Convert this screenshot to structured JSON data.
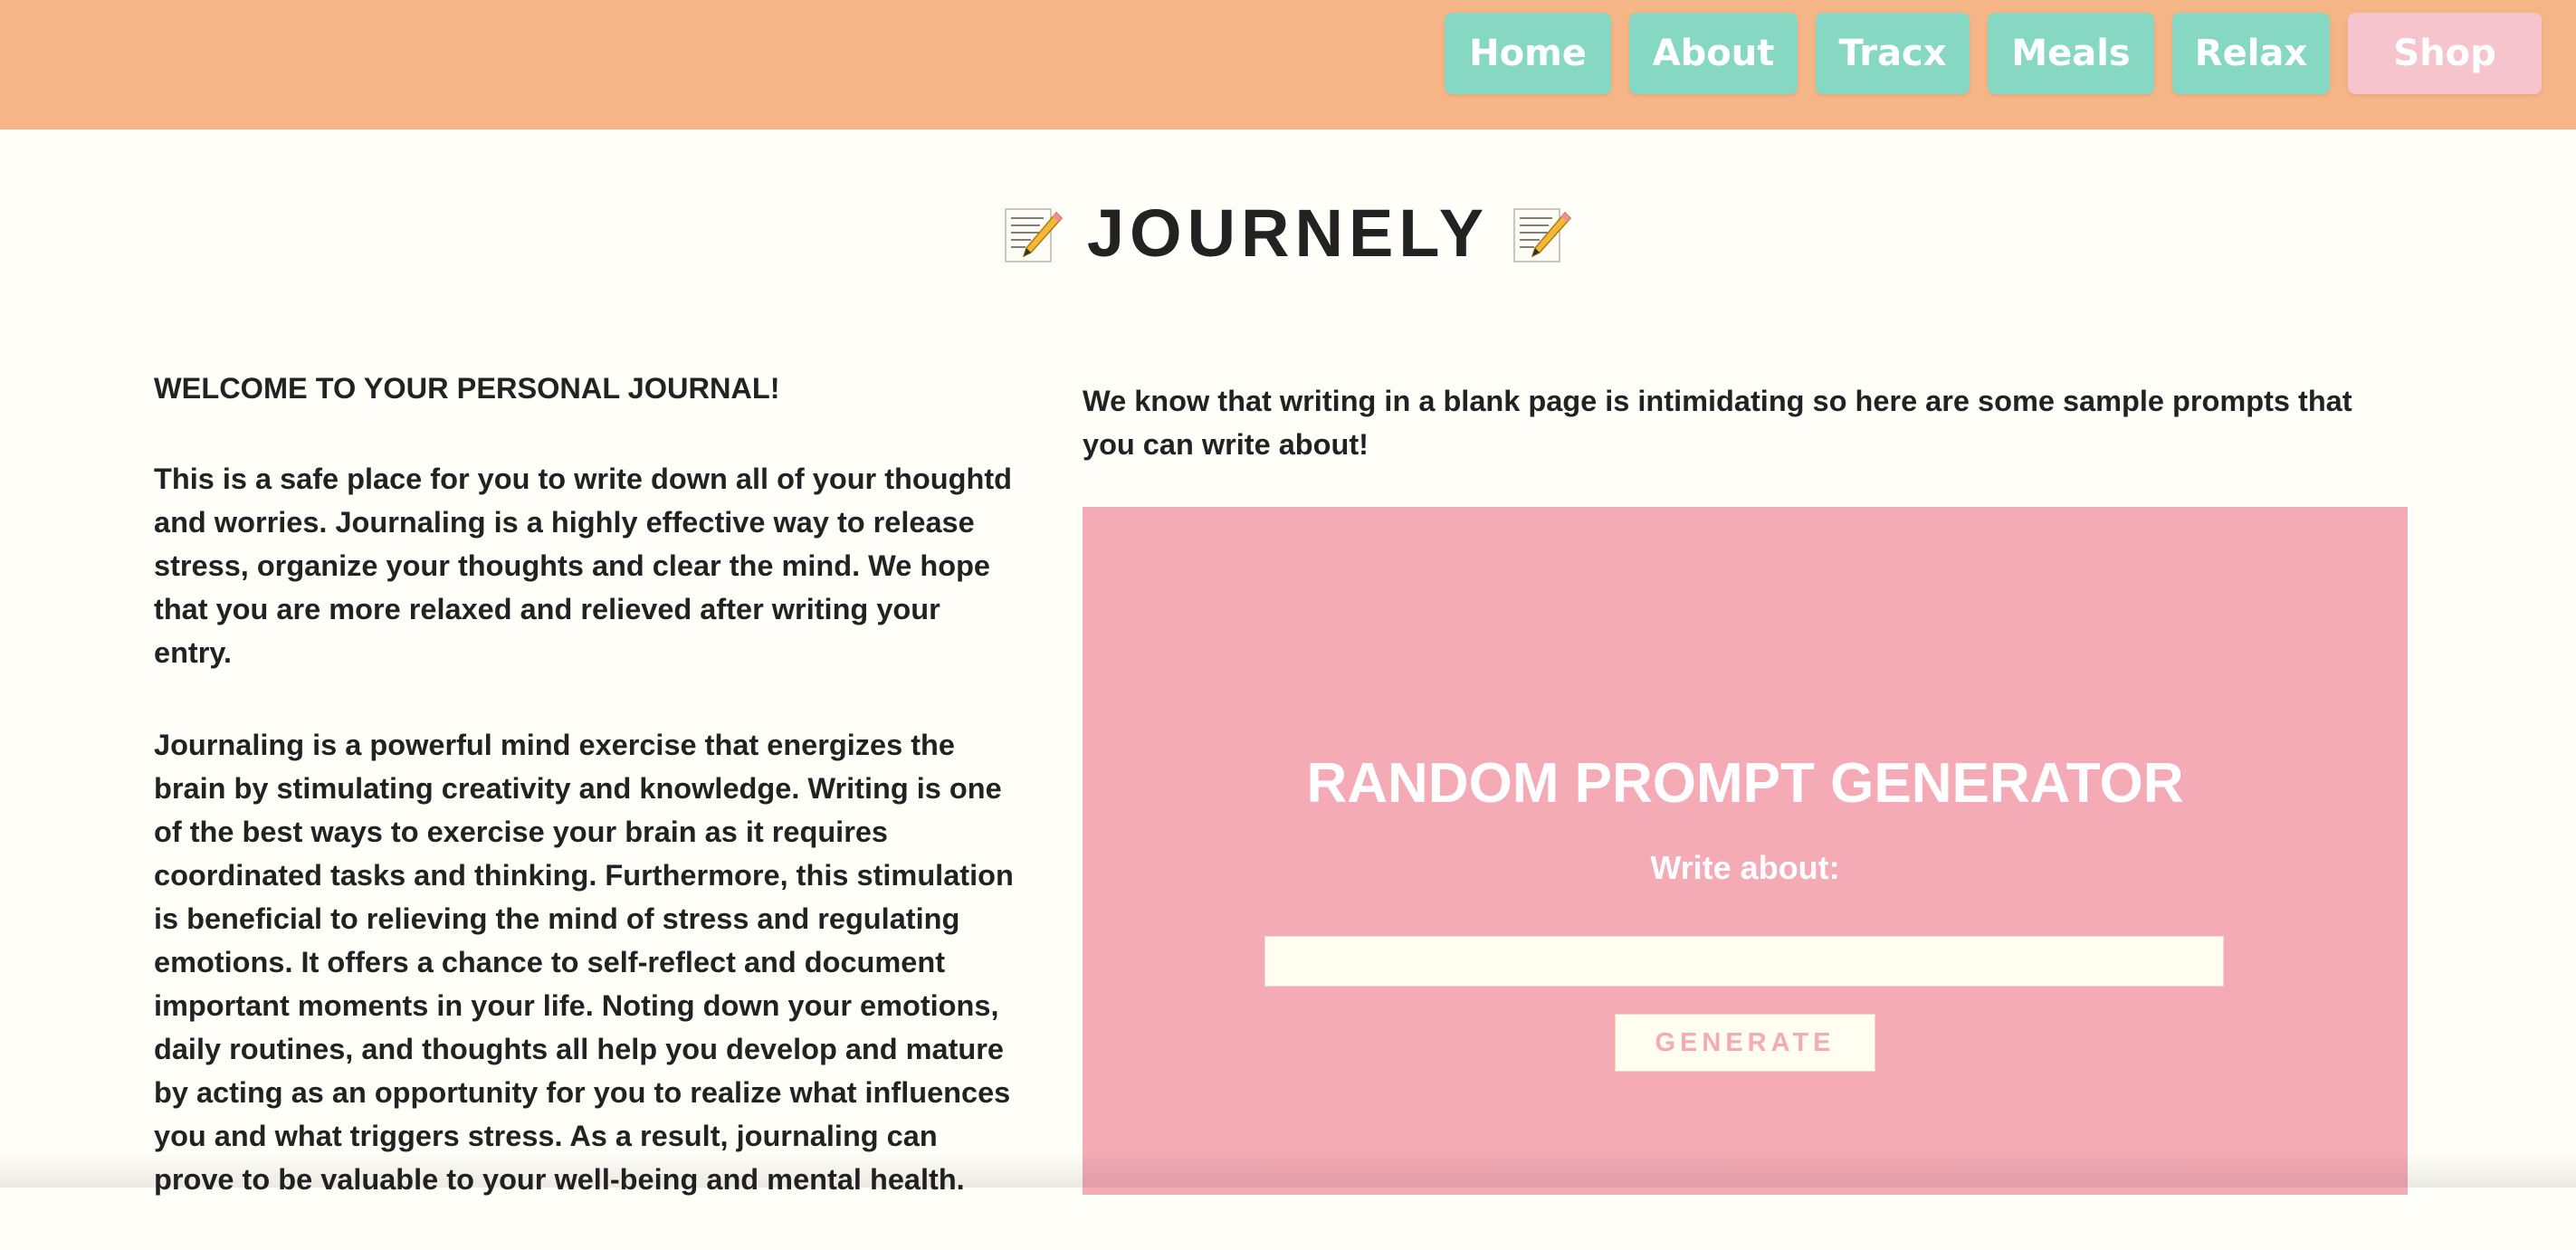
{
  "nav": {
    "items": [
      {
        "label": "Home"
      },
      {
        "label": "About"
      },
      {
        "label": "Tracx"
      },
      {
        "label": "Meals"
      },
      {
        "label": "Relax"
      },
      {
        "label": "Shop"
      }
    ]
  },
  "header": {
    "title": "JOURNELY",
    "icon": "memo-icon"
  },
  "left": {
    "welcome": "WELCOME TO YOUR PERSONAL JOURNAL!",
    "para1": "This is a safe place for you to write down all of your thoughtd and worries. Journaling is a highly effective way to release stress, organize your thoughts and clear the mind. We hope that you are more relaxed and relieved after writing your entry.",
    "para2": "Journaling is a powerful mind exercise that energizes the brain by stimulating creativity and knowledge. Writing is one of the best ways to exercise your brain as it requires coordinated tasks and thinking. Furthermore, this stimulation is beneficial to relieving the mind of stress and regulating emotions. It offers a chance to self-reflect and document important moments in your life. Noting down your emotions, daily routines, and thoughts all help you develop and mature by acting as an opportunity for you to realize what influences you and what triggers stress. As a result, journaling can prove to be valuable to your well-being and mental health."
  },
  "right": {
    "intro": "We know that writing in a blank page is intimidating so here are some sample prompts that you can write about!"
  },
  "generator": {
    "title": "RANDOM PROMPT GENERATOR",
    "label": "Write about:",
    "value": "",
    "button": "GENERATE"
  },
  "colors": {
    "navbar": "#f5b587",
    "nav_button": "#87d8c2",
    "shop_button": "#f6c4cc",
    "generator_bg": "#f4abb6",
    "page_bg": "#fffef8"
  }
}
